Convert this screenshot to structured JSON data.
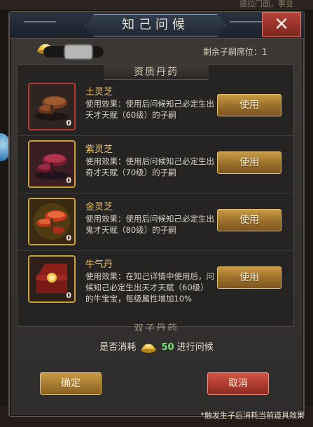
{
  "background": {
    "top_hint": "插拉门面，事变"
  },
  "dialog": {
    "title": "知己问候",
    "close_label": "✕",
    "remaining_seats_label": "剩余子嗣席位：",
    "remaining_seats_value": "1",
    "section_title": "资质丹药",
    "next_section_title": "双子丹药",
    "items": [
      {
        "name": "土灵芝",
        "description": "使用效果：使用后问候知己必定生出天才天赋（60级）的子嗣",
        "count": "0",
        "use_label": "使用",
        "frame": "red",
        "icon": "mushroom-icon"
      },
      {
        "name": "紫灵芝",
        "description": "使用效果：使用后问候知己必定生出奇才天赋（70级）的子嗣",
        "count": "0",
        "use_label": "使用",
        "frame": "gold",
        "icon": "mushroom-icon"
      },
      {
        "name": "金灵芝",
        "description": "使用效果：使用后问候知己必定生出鬼才天赋（80级）的子嗣",
        "count": "0",
        "use_label": "使用",
        "frame": "gold",
        "icon": "mushroom-icon"
      },
      {
        "name": "牛气丹",
        "description": "使用效果：在知己详情中使用后，问候知己必定生出天才天赋（60级）的牛宝宝，每级属性增加10%",
        "count": "0",
        "use_label": "使用",
        "frame": "gold",
        "icon": "pill-box-icon"
      }
    ],
    "confirm_prefix": "是否消耗",
    "confirm_amount": "50",
    "confirm_suffix": "进行问候",
    "ok_label": "确定",
    "cancel_label": "取消"
  },
  "footnote": "*触发生子后消耗当前道具效果",
  "colors": {
    "accent_gold": "#c99b45",
    "cancel_red": "#d25444",
    "name_gold": "#f0c46a",
    "amount_green": "#7ee07a"
  }
}
